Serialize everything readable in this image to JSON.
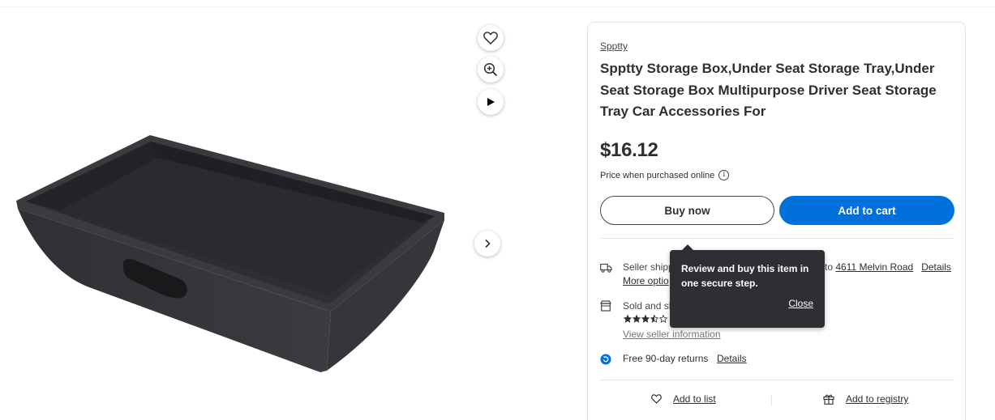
{
  "colors": {
    "accent": "#0071dc",
    "text": "#2e2f32",
    "tooltip_bg": "#2e2f32",
    "product": "#2b2c2e"
  },
  "image_actions": {
    "favorite_icon": "heart-icon",
    "zoom_icon": "zoom-in-icon",
    "play_icon": "play-icon",
    "next_icon": "chevron-right-icon"
  },
  "product": {
    "brand": "Spptty",
    "title": "Spptty Storage Box,Under Seat Storage Tray,Under Seat Storage Box Multipurpose Driver Seat Storage Tray Car Accessories For",
    "price": "$16.12",
    "price_note": "Price when purchased online",
    "info_icon": "i"
  },
  "actions": {
    "buy_now": "Buy now",
    "add_to_cart": "Add to cart"
  },
  "fulfillment": {
    "shipping_text": "Seller shipp",
    "shipping_to": "to",
    "address": "4611 Melvin Road",
    "details": "Details",
    "more_options": "More optio",
    "sold_by": "Sold and sh",
    "rating": 3.5,
    "rating_max": 5,
    "seller_info": "View seller information",
    "returns": "Free 90-day returns",
    "returns_details": "Details"
  },
  "lists": {
    "add_to_list": "Add to list",
    "add_to_registry": "Add to registry"
  },
  "tooltip": {
    "text": "Review and buy this item in one secure step.",
    "close": "Close"
  }
}
